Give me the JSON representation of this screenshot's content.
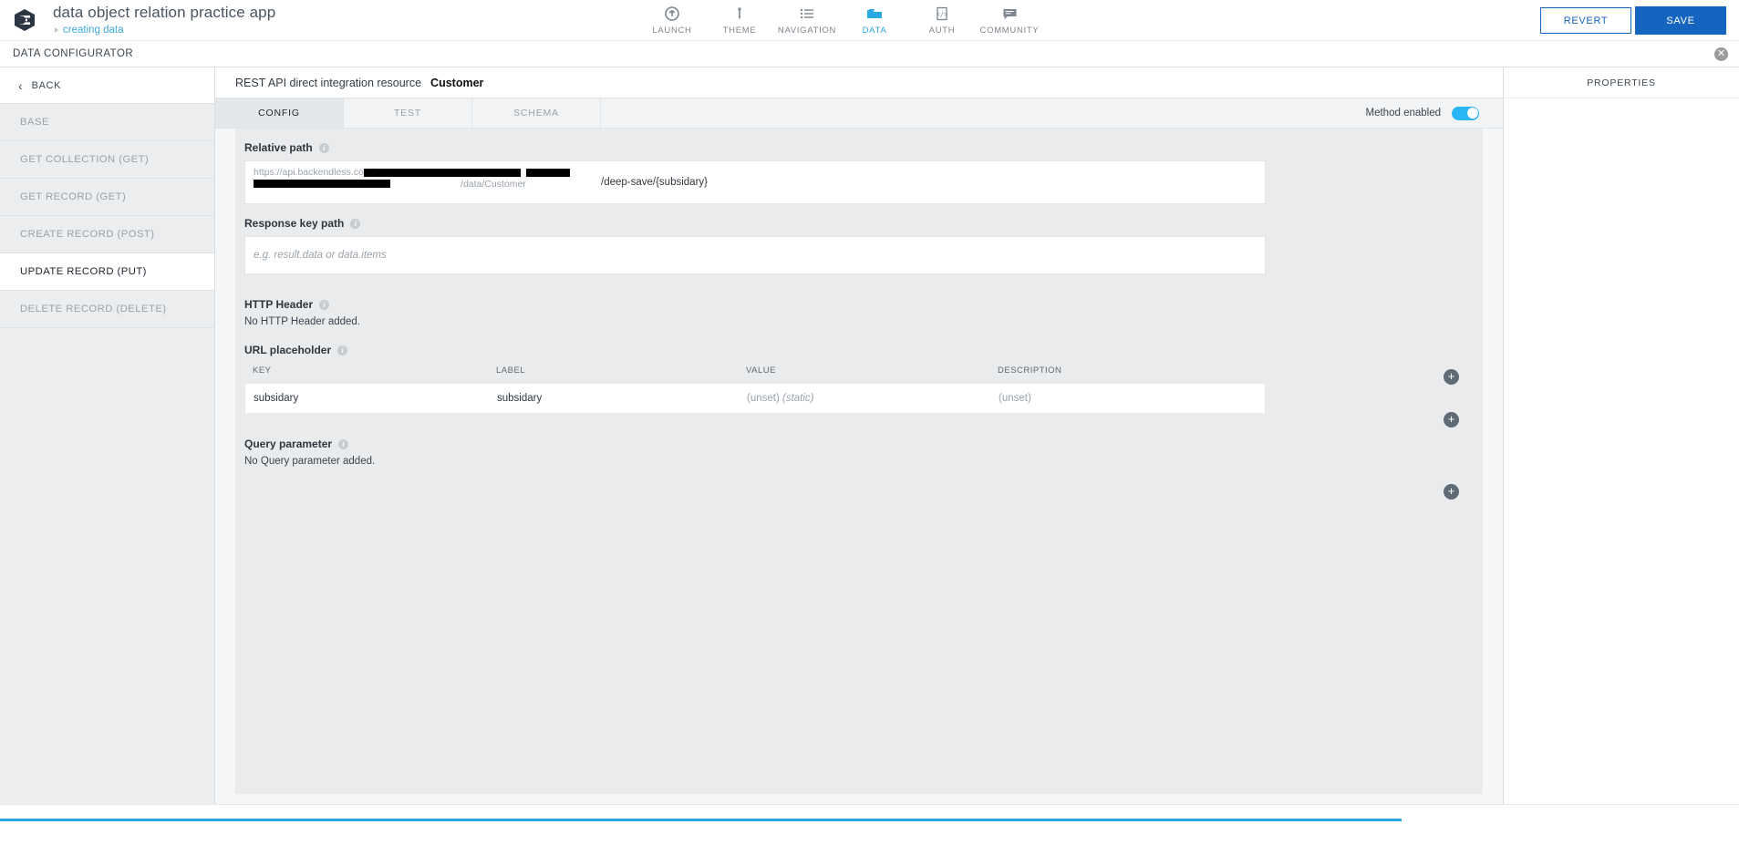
{
  "topbar": {
    "app_title": "data object relation practice app",
    "app_subtitle": "creating data",
    "logo_icon": "backendless-logo-icon",
    "nav": [
      {
        "label": "LAUNCH",
        "icon": "launch-arrow-up-icon",
        "active": false
      },
      {
        "label": "THEME",
        "icon": "eyedropper-icon",
        "active": false
      },
      {
        "label": "NAVIGATION",
        "icon": "list-icon",
        "active": false
      },
      {
        "label": "DATA",
        "icon": "folder-icon",
        "active": true
      },
      {
        "label": "AUTH",
        "icon": "code-document-icon",
        "active": false
      },
      {
        "label": "COMMUNITY",
        "icon": "chat-bubble-icon",
        "active": false
      }
    ],
    "revert_label": "REVERT",
    "save_label": "SAVE",
    "accent_color": "#29a9e1",
    "save_color": "#1565c0"
  },
  "configurator": {
    "title": "DATA CONFIGURATOR",
    "close_icon": "close-circle-icon"
  },
  "sidebar": {
    "back_label": "BACK",
    "back_icon": "chevron-left-icon",
    "items": [
      {
        "label": "BASE",
        "active": false
      },
      {
        "label": "GET COLLECTION (GET)",
        "active": false
      },
      {
        "label": "GET RECORD (GET)",
        "active": false
      },
      {
        "label": "CREATE RECORD (POST)",
        "active": false
      },
      {
        "label": "UPDATE RECORD (PUT)",
        "active": true
      },
      {
        "label": "DELETE RECORD (DELETE)",
        "active": false
      }
    ]
  },
  "resource": {
    "prefix": "REST API direct integration resource",
    "name": "Customer"
  },
  "tabs": [
    {
      "label": "CONFIG",
      "active": true
    },
    {
      "label": "TEST",
      "active": false
    },
    {
      "label": "SCHEMA",
      "active": false
    }
  ],
  "method_toggle": {
    "label": "Method enabled",
    "enabled": true,
    "color": "#29b6f6"
  },
  "relative_path": {
    "label": "Relative path",
    "info_icon": "info-icon",
    "base_url_prefix": "https://api.backendless.com/",
    "base_url_suffix": "/data/Customer",
    "redacted": true,
    "value": "/deep-save/{subsidary}"
  },
  "response_key_path": {
    "label": "Response key path",
    "info_icon": "info-icon",
    "value": "",
    "placeholder": "e.g. result.data or data.items"
  },
  "http_header": {
    "label": "HTTP Header",
    "info_icon": "info-icon",
    "empty_text": "No HTTP Header added.",
    "add_icon": "plus-circle-icon"
  },
  "url_placeholder": {
    "label": "URL placeholder",
    "info_icon": "info-icon",
    "add_icon": "plus-circle-icon",
    "columns": [
      "KEY",
      "LABEL",
      "VALUE",
      "DESCRIPTION"
    ],
    "rows": [
      {
        "key": "subsidary",
        "label": "subsidary",
        "value": "(unset)",
        "value_kind": "(static)",
        "description": "(unset)"
      }
    ]
  },
  "query_parameter": {
    "label": "Query parameter",
    "info_icon": "info-icon",
    "empty_text": "No Query parameter added.",
    "add_icon": "plus-circle-icon"
  },
  "properties": {
    "title": "PROPERTIES"
  }
}
